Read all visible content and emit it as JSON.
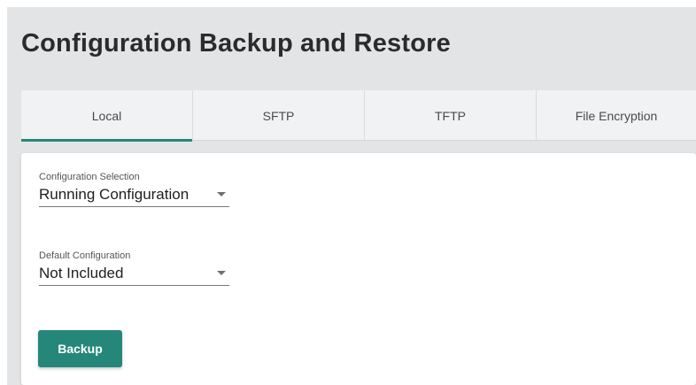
{
  "header": {
    "title": "Configuration Backup and Restore"
  },
  "tabs": [
    {
      "label": "Local",
      "active": true
    },
    {
      "label": "SFTP",
      "active": false
    },
    {
      "label": "TFTP",
      "active": false
    },
    {
      "label": "File Encryption",
      "active": false
    }
  ],
  "form": {
    "config_selection": {
      "label": "Configuration Selection",
      "value": "Running Configuration"
    },
    "default_config": {
      "label": "Default Configuration",
      "value": "Not Included"
    },
    "backup_label": "Backup"
  },
  "colors": {
    "accent": "#25877a",
    "page_bg": "#e3e4e6"
  }
}
